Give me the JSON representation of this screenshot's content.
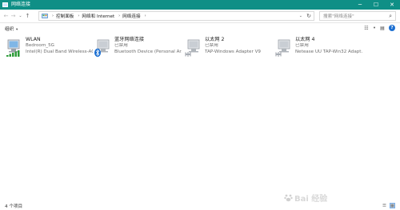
{
  "window": {
    "title": "网络连接",
    "minimize_glyph": "─",
    "maximize_glyph": "☐",
    "close_glyph": "✕"
  },
  "nav": {
    "back_glyph": "←",
    "forward_glyph": "→",
    "recent_glyph": "⌄",
    "up_glyph": "↑",
    "breadcrumbs": [
      "控制面板",
      "网络和 Internet",
      "网络连接"
    ],
    "sep_glyph": "›",
    "dropdown_glyph": "⌄",
    "refresh_glyph": "↻",
    "search_placeholder": "搜索\"网络连接\"",
    "search_glyph": "⌕"
  },
  "command_bar": {
    "organize_label": "组织",
    "organize_chevron": "▾",
    "view_glyph": "☷",
    "view_chevron": "▾",
    "pane_glyph": "▤",
    "help_glyph": "?"
  },
  "adapters": [
    {
      "name": "WLAN",
      "status": "Bedroom_5G",
      "device": "Intel(R) Dual Band Wireless-AC...",
      "icon": "wifi-adapter-icon"
    },
    {
      "name": "蓝牙网络连接",
      "status": "已禁用",
      "device": "Bluetooth Device (Personal Ar...",
      "icon": "bluetooth-adapter-icon"
    },
    {
      "name": "以太网 2",
      "status": "已禁用",
      "device": "TAP-Windows Adapter V9",
      "icon": "ethernet-adapter-icon"
    },
    {
      "name": "以太网 4",
      "status": "已禁用",
      "device": "Netease UU TAP-Win32 Adapt...",
      "icon": "ethernet-adapter-icon"
    }
  ],
  "status_bar": {
    "item_count": "4 个项目",
    "details_view_glyph": "☰",
    "tiles_view_glyph": "▦"
  },
  "watermark": {
    "text": "Bai 经验"
  },
  "colors": {
    "titlebar": "#0f8f86",
    "accent": "#1c6fd1"
  }
}
